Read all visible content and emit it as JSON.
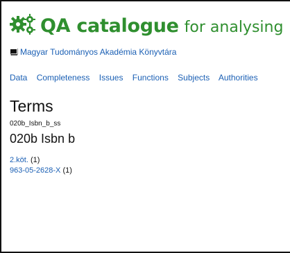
{
  "header": {
    "title": "QA catalogue",
    "subtitle": "for analysing",
    "logo_icon": "gears-icon",
    "brand_color": "#2f8f2f"
  },
  "library": {
    "icon": "book-icon",
    "name": "Magyar Tudományos Akadémia Könyvtára"
  },
  "nav": {
    "items": [
      "Data",
      "Completeness",
      "Issues",
      "Functions",
      "Subjects",
      "Authorities"
    ]
  },
  "main": {
    "title": "Terms",
    "field_code": "020b_Isbn_b_ss",
    "field_name": "020b Isbn b",
    "terms": [
      {
        "term": "2.köt.",
        "count": "(1)"
      },
      {
        "term": "963-05-2628-X",
        "count": "(1)"
      }
    ]
  },
  "colors": {
    "link": "#1a5fb4",
    "text": "#111111"
  }
}
